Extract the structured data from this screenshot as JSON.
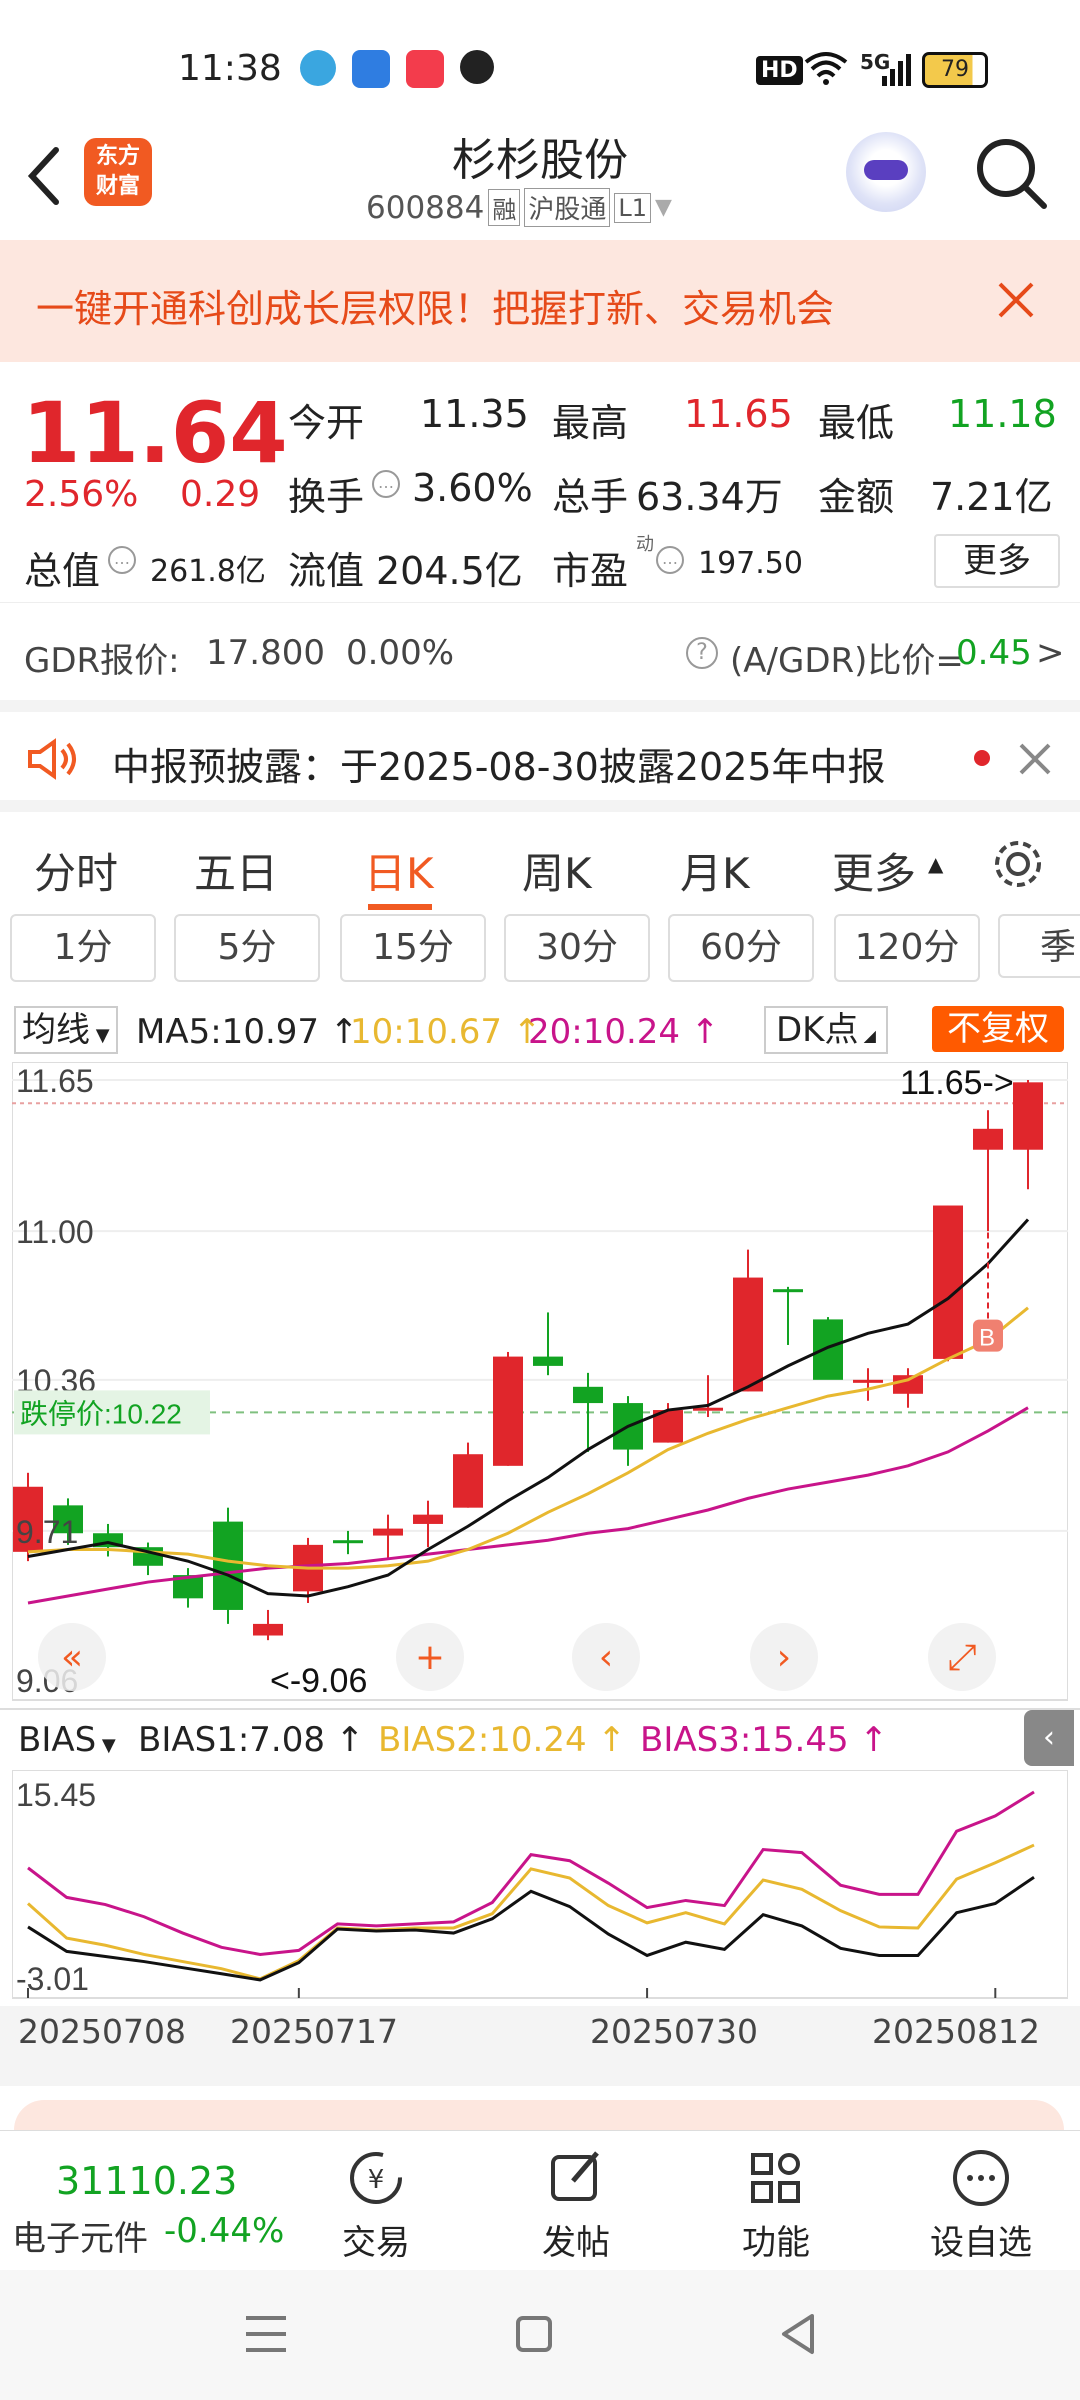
{
  "status": {
    "time": "11:38",
    "battery": "79",
    "network": "5G",
    "hd": "HD"
  },
  "header": {
    "title": "杉杉股份",
    "code": "600884",
    "tag_rong": "融",
    "tag_hgt": "沪股通",
    "tag_level": "L1",
    "logo_line1": "东方",
    "logo_line2": "财富"
  },
  "banner": {
    "text": "一键开通科创成长层权限！把握打新、交易机会"
  },
  "quote": {
    "price": "11.64",
    "change_pct": "2.56%",
    "change_amt": "0.29",
    "open_label": "今开",
    "open": "11.35",
    "high_label": "最高",
    "high": "11.65",
    "low_label": "最低",
    "low": "11.18",
    "turnover_label": "换手",
    "turnover": "3.60%",
    "volume_label": "总手",
    "volume": "63.34万",
    "amount_label": "金额",
    "amount": "7.21亿",
    "mcap_label": "总值",
    "mcap": "261.8亿",
    "float_label": "流值",
    "float": "204.5亿",
    "pe_label": "市盈",
    "pe_sup": "动",
    "pe": "197.50",
    "more_button": "更多"
  },
  "gdr": {
    "label": "GDR报价:",
    "price": "17.800",
    "pct": "0.00%",
    "ratio_label": "(A/GDR)比价=",
    "ratio": "0.45",
    "arrow": ">"
  },
  "notice": {
    "text": "中报预披露：于2025-08-30披露2025年中报"
  },
  "tabs": [
    "分时",
    "五日",
    "日K",
    "周K",
    "月K",
    "更多"
  ],
  "active_tab": 2,
  "periods": [
    "1分",
    "5分",
    "15分",
    "30分",
    "60分",
    "120分",
    "季"
  ],
  "ma": {
    "selector": "均线",
    "ma5": "MA5:10.97",
    "ma10": "10:10.67",
    "ma20": "20:10.24",
    "dk": "DK点",
    "fq": "不复权"
  },
  "bias": {
    "selector": "BIAS",
    "b1": "BIAS1:7.08",
    "b2": "BIAS2:10.24",
    "b3": "BIAS3:15.45"
  },
  "colors": {
    "up": "#e0262c",
    "down": "#12a322",
    "ma5": "#111111",
    "ma10": "#e8b830",
    "ma20": "#c8148a",
    "accent": "#ff5a00"
  },
  "chart_data": {
    "type": "candlestick",
    "y_ticks": [
      "11.65",
      "11.00",
      "10.36",
      "9.71",
      "9.06"
    ],
    "ylim": [
      9.06,
      11.65
    ],
    "high_label": "11.65->",
    "low_label": "<-9.06",
    "limit_down_label": "跌停价:10.22",
    "limit_down": 10.22,
    "b_marker": "B",
    "candles": [
      {
        "o": 9.62,
        "c": 9.9,
        "h": 9.96,
        "l": 9.58
      },
      {
        "o": 9.82,
        "c": 9.7,
        "h": 9.85,
        "l": 9.65
      },
      {
        "o": 9.7,
        "c": 9.64,
        "h": 9.74,
        "l": 9.6
      },
      {
        "o": 9.64,
        "c": 9.56,
        "h": 9.66,
        "l": 9.52
      },
      {
        "o": 9.52,
        "c": 9.42,
        "h": 9.55,
        "l": 9.38
      },
      {
        "o": 9.75,
        "c": 9.37,
        "h": 9.81,
        "l": 9.31
      },
      {
        "o": 9.26,
        "c": 9.31,
        "h": 9.37,
        "l": 9.24
      },
      {
        "o": 9.45,
        "c": 9.65,
        "h": 9.68,
        "l": 9.4
      },
      {
        "o": 9.67,
        "c": 9.66,
        "h": 9.71,
        "l": 9.61
      },
      {
        "o": 9.69,
        "c": 9.72,
        "h": 9.78,
        "l": 9.59
      },
      {
        "o": 9.74,
        "c": 9.78,
        "h": 9.84,
        "l": 9.64
      },
      {
        "o": 9.81,
        "c": 10.04,
        "h": 10.09,
        "l": 9.81
      },
      {
        "o": 9.99,
        "c": 10.46,
        "h": 10.48,
        "l": 9.99
      },
      {
        "o": 10.46,
        "c": 10.42,
        "h": 10.65,
        "l": 10.38
      },
      {
        "o": 10.33,
        "c": 10.26,
        "h": 10.39,
        "l": 10.05
      },
      {
        "o": 10.26,
        "c": 10.06,
        "h": 10.29,
        "l": 9.99
      },
      {
        "o": 10.09,
        "c": 10.23,
        "h": 10.26,
        "l": 10.09
      },
      {
        "o": 10.24,
        "c": 10.24,
        "h": 10.38,
        "l": 10.2
      },
      {
        "o": 10.31,
        "c": 10.8,
        "h": 10.92,
        "l": 10.31
      },
      {
        "o": 10.75,
        "c": 10.74,
        "h": 10.76,
        "l": 10.51
      },
      {
        "o": 10.62,
        "c": 10.36,
        "h": 10.63,
        "l": 10.38
      },
      {
        "o": 10.36,
        "c": 10.36,
        "h": 10.41,
        "l": 10.27
      },
      {
        "o": 10.3,
        "c": 10.38,
        "h": 10.41,
        "l": 10.24
      },
      {
        "o": 10.45,
        "c": 11.11,
        "h": 11.11,
        "l": 10.44
      },
      {
        "o": 11.35,
        "c": 11.44,
        "h": 11.52,
        "l": 11.0
      },
      {
        "o": 11.35,
        "c": 11.64,
        "h": 11.65,
        "l": 11.18
      }
    ],
    "ma5": [
      9.6,
      9.63,
      9.66,
      9.62,
      9.58,
      9.52,
      9.44,
      9.43,
      9.47,
      9.52,
      9.63,
      9.73,
      9.84,
      9.94,
      10.06,
      10.16,
      10.23,
      10.25,
      10.33,
      10.42,
      10.5,
      10.56,
      10.6,
      10.71,
      10.86,
      11.05
    ],
    "ma10": [
      9.62,
      9.63,
      9.63,
      9.62,
      9.61,
      9.58,
      9.56,
      9.55,
      9.55,
      9.56,
      9.58,
      9.63,
      9.7,
      9.79,
      9.87,
      9.96,
      10.06,
      10.13,
      10.19,
      10.24,
      10.29,
      10.32,
      10.36,
      10.45,
      10.53,
      10.67
    ],
    "ma20": [
      9.4,
      9.43,
      9.46,
      9.49,
      9.51,
      9.53,
      9.55,
      9.56,
      9.57,
      9.59,
      9.61,
      9.63,
      9.65,
      9.67,
      9.7,
      9.72,
      9.76,
      9.8,
      9.85,
      9.89,
      9.92,
      9.95,
      9.99,
      10.05,
      10.14,
      10.24
    ],
    "bias_ylim": [
      -3.01,
      15.45
    ],
    "bias_ticks": [
      "15.45",
      "-3.01"
    ],
    "bias1": [
      2.2,
      -0.2,
      -0.7,
      -1.2,
      -1.8,
      -2.4,
      -3.0,
      -1.3,
      2.0,
      1.8,
      1.9,
      1.6,
      3.0,
      5.7,
      4.2,
      1.5,
      -0.6,
      0.7,
      0.0,
      3.4,
      2.3,
      0.1,
      -0.6,
      -0.6,
      3.6,
      4.5,
      7.08
    ],
    "bias2": [
      4.5,
      1.1,
      0.4,
      -0.5,
      -1.2,
      -1.9,
      -2.9,
      -1.1,
      2.1,
      1.9,
      2.1,
      2.1,
      3.5,
      7.9,
      7.0,
      4.3,
      2.6,
      3.6,
      2.5,
      6.8,
      5.9,
      3.8,
      2.2,
      2.1,
      6.9,
      8.5,
      10.24
    ],
    "bias3": [
      8.0,
      5.1,
      4.4,
      3.2,
      1.6,
      0.2,
      -0.5,
      -0.1,
      2.5,
      2.3,
      2.5,
      2.7,
      4.6,
      9.3,
      8.7,
      6.5,
      4.1,
      4.8,
      4.3,
      9.8,
      9.5,
      6.3,
      5.4,
      5.4,
      11.6,
      13.1,
      15.45
    ],
    "x_labels": [
      "20250708",
      "20250717",
      "20250730",
      "20250812"
    ]
  },
  "bottom": {
    "index_value": "31110.23",
    "index_name": "电子元件",
    "index_pct": "-0.44%",
    "trade": "交易",
    "post": "发帖",
    "func": "功能",
    "watch": "设自选"
  }
}
